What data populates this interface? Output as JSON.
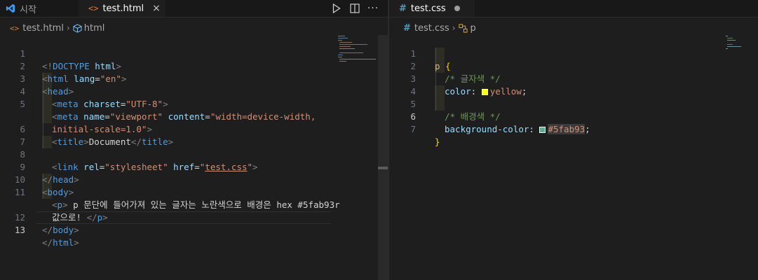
{
  "left": {
    "tabs": [
      {
        "label": "시작",
        "active": false
      },
      {
        "label": "test.html",
        "active": true
      }
    ],
    "breadcrumb": [
      "test.html",
      "html"
    ],
    "lines": [
      {
        "num": "1"
      },
      {
        "num": "2"
      },
      {
        "num": "3"
      },
      {
        "num": "4"
      },
      {
        "num": "5"
      },
      {
        "num": ""
      },
      {
        "num": "6"
      },
      {
        "num": "7"
      },
      {
        "num": "8"
      },
      {
        "num": "9"
      },
      {
        "num": "10"
      },
      {
        "num": "11"
      },
      {
        "num": ""
      },
      {
        "num": "12"
      },
      {
        "num": "13"
      }
    ],
    "code": {
      "doctype": "<!DOCTYPE html>",
      "html_open": "<html lang=\"en\">",
      "head_open": "<head>",
      "meta_charset": "<meta charset=\"UTF-8\">",
      "meta_viewport_1": "<meta name=\"viewport\" content=\"width=device-width,",
      "meta_viewport_2": "initial-scale=1.0\">",
      "title": "<title>Document</title>",
      "link": "<link rel=\"stylesheet\" href=\"test.css\">",
      "head_close": "</head>",
      "body_open": "<body>",
      "p_1_tag": "<p>",
      "p_1_text": " p 문단에 들어가져 있는 글자는 노란색으로 배경은 hex #5fab93r",
      "p_2_text": "값으로! ",
      "p_2_tag": "</p>",
      "body_close": "</body>",
      "html_close": "</html>"
    },
    "current_line": "13"
  },
  "right": {
    "tabs": [
      {
        "label": "test.css",
        "active": true,
        "dirty": true
      }
    ],
    "breadcrumb": [
      "test.css",
      "p"
    ],
    "lines": [
      {
        "num": "1"
      },
      {
        "num": "2"
      },
      {
        "num": "3"
      },
      {
        "num": "4"
      },
      {
        "num": "5"
      },
      {
        "num": "6"
      },
      {
        "num": "7"
      }
    ],
    "code": {
      "selector": "p",
      "brace_open": "{",
      "comment_1": "/* 글자색 */",
      "prop_color": "color",
      "val_color": "yellow",
      "comment_2": "/* 배경색 */",
      "prop_bg": "background-color",
      "val_bg": "#5fab93",
      "brace_close": "}",
      "colon": ":",
      "semicolon": ";"
    },
    "current_line": "6",
    "swatches": {
      "yellow": "#ffff00",
      "bg": "#5fab93"
    }
  },
  "icons": {
    "vscode": "vscode-logo-icon",
    "html_file": "html-file-icon",
    "css_file": "css-file-icon",
    "run": "run-icon",
    "split": "split-editor-icon",
    "more": "more-actions-icon",
    "element": "element-icon",
    "selector": "selector-icon"
  },
  "colors": {
    "editor_bg": "#1e1e1e",
    "tabbar_bg": "#181818",
    "html_icon": "#e37933",
    "css_icon": "#519aba",
    "vscode_blue": "#3e9bf0"
  }
}
